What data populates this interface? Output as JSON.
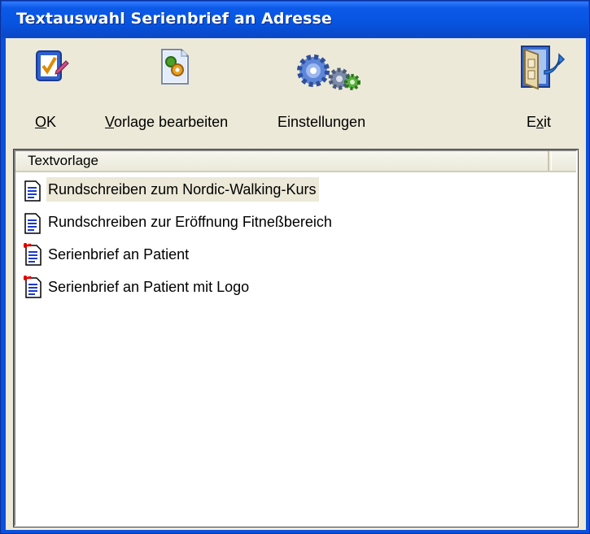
{
  "window": {
    "title": "Textauswahl Serienbrief an Adresse"
  },
  "toolbar": {
    "ok_label": "OK",
    "ok_mnemonic": "O",
    "ok_rest": "K",
    "edit_label": "Vorlage bearbeiten",
    "edit_mnemonic": "V",
    "edit_rest": "orlage bearbeiten",
    "settings_label": "Einstellungen",
    "exit_label": "Exit",
    "exit_pre": "E",
    "exit_mnemonic": "x",
    "exit_post": "it"
  },
  "list": {
    "column_header": "Textvorlage",
    "items": [
      {
        "label": "Rundschreiben zum Nordic-Walking-Kurs",
        "icon": "document-icon",
        "selected": true
      },
      {
        "label": "Rundschreiben zur Eröffnung Fitneßbereich",
        "icon": "document-icon",
        "selected": false
      },
      {
        "label": "Serienbrief an Patient",
        "icon": "serial-letter-icon",
        "selected": false
      },
      {
        "label": "Serienbrief an Patient mit Logo",
        "icon": "serial-letter-icon",
        "selected": false
      }
    ]
  },
  "colors": {
    "titlebar": "#0754e0",
    "face": "#ece9d8",
    "accent_red": "#e00000"
  }
}
